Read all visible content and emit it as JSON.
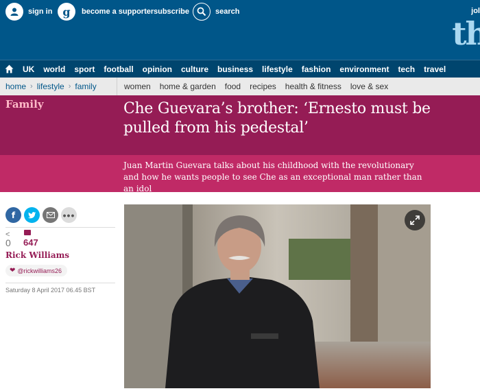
{
  "header": {
    "sign_in": "sign in",
    "become_supporter": "become a supporter",
    "subscribe": "subscribe",
    "search": "search",
    "jobs_fragment": "jol",
    "logo_fragment": "th"
  },
  "nav": {
    "items": [
      "UK",
      "world",
      "sport",
      "football",
      "opinion",
      "culture",
      "business",
      "lifestyle",
      "fashion",
      "environment",
      "tech",
      "travel"
    ]
  },
  "subnav": {
    "breadcrumb": [
      "home",
      "lifestyle",
      "family"
    ],
    "items": [
      "women",
      "home & garden",
      "food",
      "recipes",
      "health & fitness",
      "love & sex"
    ]
  },
  "article": {
    "section": "Family",
    "headline": "Che Guevara’s brother: ‘Ernesto must be pulled from his pedestal’",
    "standfirst": "Juan Martin Guevara talks about his childhood with the revolutionary and how he wants people to see Che as an exceptional man rather than an idol",
    "share_count": "0",
    "comment_count": "647",
    "author": "Rick Williams",
    "twitter_handle": "@rickwilliams26",
    "date": "Saturday 8 April 2017 06.45 BST"
  },
  "colors": {
    "header_blue": "#005689",
    "nav_blue": "#00456e",
    "lifestyle_dark": "#951c55",
    "lifestyle_mid": "#c02a66",
    "facebook": "#3067a3",
    "twitter": "#03b3ee",
    "email": "#767676",
    "more": "#dcdcdc"
  }
}
